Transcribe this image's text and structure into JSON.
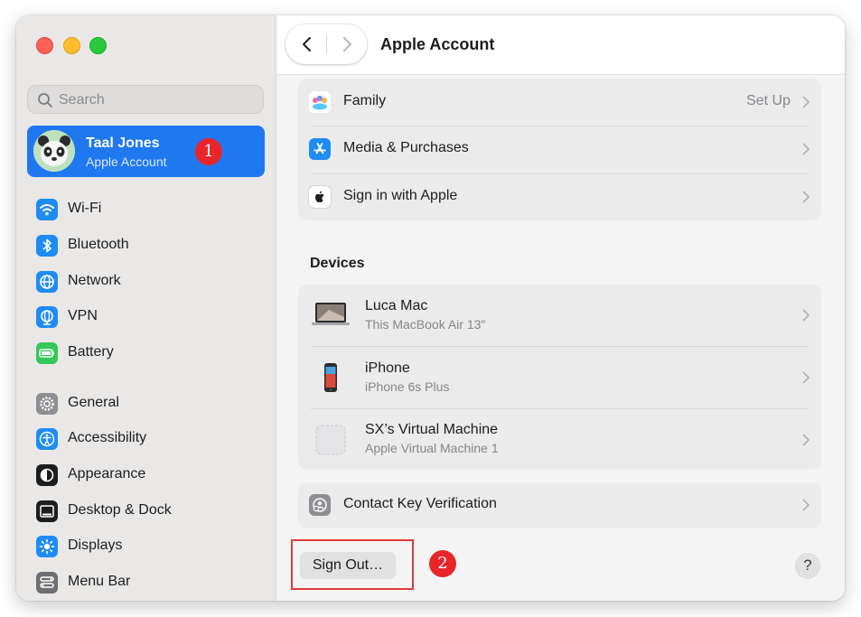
{
  "sidebar": {
    "search_placeholder": "Search",
    "account": {
      "name": "Taal Jones",
      "subtitle": "Apple Account",
      "annotation": "1"
    },
    "items": [
      {
        "label": "Wi-Fi",
        "icon": "wifi-icon",
        "color": "#1f8bf5"
      },
      {
        "label": "Bluetooth",
        "icon": "bluetooth-icon",
        "color": "#1f8bf5"
      },
      {
        "label": "Network",
        "icon": "globe-icon",
        "color": "#1f8bf5"
      },
      {
        "label": "VPN",
        "icon": "vpn-globe-icon",
        "color": "#1f8bf5"
      },
      {
        "label": "Battery",
        "icon": "battery-icon",
        "color": "#34c759"
      },
      {
        "label": "General",
        "icon": "gear-icon",
        "color": "#8e8e93"
      },
      {
        "label": "Accessibility",
        "icon": "accessibility-icon",
        "color": "#1f8bf5"
      },
      {
        "label": "Appearance",
        "icon": "appearance-icon",
        "color": "#1d1d1f"
      },
      {
        "label": "Desktop & Dock",
        "icon": "dock-icon",
        "color": "#1d1d1f"
      },
      {
        "label": "Displays",
        "icon": "sun-icon",
        "color": "#1f8bf5"
      },
      {
        "label": "Menu Bar",
        "icon": "menu-bar-icon",
        "color": "#6e6e73"
      }
    ]
  },
  "header": {
    "title": "Apple Account"
  },
  "services": [
    {
      "label": "Family",
      "value": "Set Up",
      "icon": "family-icon"
    },
    {
      "label": "Media & Purchases",
      "value": "",
      "icon": "app-store-icon"
    },
    {
      "label": "Sign in with Apple",
      "value": "",
      "icon": "apple-logo-icon"
    }
  ],
  "devices": {
    "title": "Devices",
    "items": [
      {
        "name": "Luca Mac",
        "detail": "This MacBook Air 13″",
        "icon": "macbook-icon"
      },
      {
        "name": "iPhone",
        "detail": "iPhone 6s Plus",
        "icon": "iphone-icon"
      },
      {
        "name": "SX’s Virtual Machine",
        "detail": "Apple Virtual Machine 1",
        "icon": "virtual-machine-icon"
      }
    ]
  },
  "contact_key": {
    "label": "Contact Key Verification",
    "icon": "contact-key-icon"
  },
  "footer": {
    "sign_out_label": "Sign Out…",
    "help_label": "?",
    "annotation": "2"
  },
  "colors": {
    "accent": "#1f78f0",
    "annotation_red": "#e8262a"
  }
}
